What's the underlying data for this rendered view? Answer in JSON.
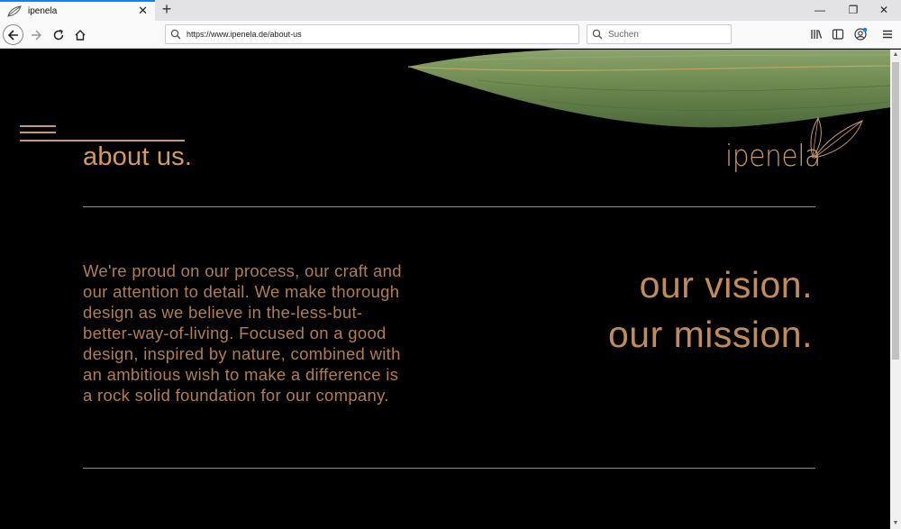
{
  "browser": {
    "tab_title": "ipenela",
    "tab_close": "✕",
    "new_tab": "+",
    "url": "https://www.ipenela.de/about-us",
    "search_placeholder": "Suchen",
    "win_minimize": "—",
    "win_restore": "❐",
    "win_close": "✕"
  },
  "page": {
    "title": "about us.",
    "logo_text": "ipenela",
    "body": "We're proud on our process, our craft and our attention to detail. We make thorough design as we believe in the-less-but-better-way-of-living. Focused on a good design, inspired by nature, combined with an ambitious wish to make a difference is a rock solid foundation for our company.",
    "body_lines": [
      "We're proud on our process, our craft and",
      "our attention to detail. We make thorough",
      "design as we believe in the-less-but-",
      "better-way-of-living. Focused on a good",
      "design, inspired by nature, combined with",
      "an ambitious wish to make a difference is",
      "a rock solid foundation for our company."
    ],
    "vision_line1": "our vision.",
    "vision_line2": "our mission."
  },
  "colors": {
    "accent": "#d49a62",
    "background": "#000000",
    "leaf": "#6f8a52"
  },
  "icons": [
    "leaf-favicon-icon",
    "back-arrow-icon",
    "forward-arrow-icon",
    "reload-icon",
    "home-icon",
    "search-icon",
    "library-icon",
    "sidebar-icon",
    "account-icon",
    "hamburger-menu-icon",
    "leaf-logo-icon"
  ]
}
